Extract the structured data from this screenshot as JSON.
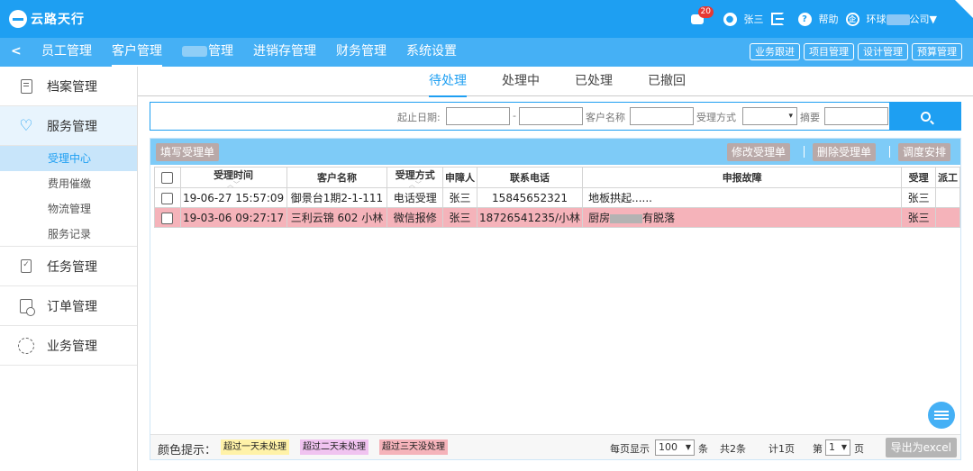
{
  "app": {
    "logo_text": "云路天行",
    "message_count": "20",
    "user_name": "张三",
    "help_label": "帮助",
    "company_prefix": "环球",
    "company_suffix": "公司▼"
  },
  "nav": {
    "back": "<",
    "items": [
      "员工管理",
      "客户管理",
      "管理",
      "进销存管理",
      "财务管理",
      "系统设置"
    ],
    "right_buttons": [
      "业务跟进",
      "项目管理",
      "设计管理",
      "预算管理"
    ]
  },
  "sidebar": {
    "groups": [
      "档案管理",
      "服务管理",
      "任务管理",
      "订单管理",
      "业务管理"
    ],
    "sub_items": [
      "受理中心",
      "费用催缴",
      "物流管理",
      "服务记录"
    ]
  },
  "tabs": [
    "待处理",
    "处理中",
    "已处理",
    "已撤回"
  ],
  "search": {
    "date_label": "起止日期:",
    "dash": "-",
    "customer_label": "客户名称",
    "method_label": "受理方式",
    "method_value": "▾",
    "summary_label": "摘要"
  },
  "toolbar": {
    "add": "填写受理单",
    "edit": "修改受理单",
    "delete": "删除受理单",
    "schedule": "调度安排"
  },
  "table": {
    "headers": [
      "受理时间",
      "客户名称",
      "受理方式",
      "申障人",
      "联系电话",
      "申报故障",
      "受理",
      "派工"
    ],
    "rows": [
      [
        "19-06-27 15:57:09",
        "御景台1期2-1-111",
        "电话受理",
        "张三",
        "15845652321",
        "地板拱起......",
        "张三",
        ""
      ],
      [
        "19-03-06 09:27:17",
        "三利云锦 602 小林",
        "微信报修",
        "张三",
        "18726541235/小林",
        "有脱落",
        "张三",
        ""
      ]
    ],
    "fault_prefix_row2": "厨房",
    "row_colors": [
      "#ffffff",
      "#f5b3ba"
    ]
  },
  "footer": {
    "legend_title": "颜色提示：",
    "legends": [
      {
        "label": "超过一天未处理",
        "color": "#fff2a8"
      },
      {
        "label": "超过二天未处理",
        "color": "#f0c3f0"
      },
      {
        "label": "超过三天没处理",
        "color": "#f5b3ba"
      }
    ],
    "per_page_label": "每页显示",
    "per_page_value": "100",
    "per_page_unit": "条",
    "total": "共2条",
    "pages": "计1页",
    "page_prefix": "第",
    "page_value": "1",
    "page_suffix": "页",
    "export": "导出为excel"
  }
}
